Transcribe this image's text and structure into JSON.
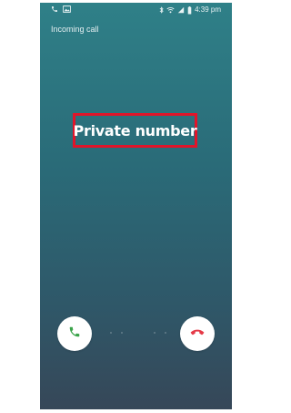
{
  "status_bar": {
    "time": "4:39 pm",
    "left_icons": [
      "phone-icon",
      "image-icon"
    ],
    "right_icons": [
      "bluetooth-icon",
      "wifi-icon",
      "signal-icon",
      "battery-icon"
    ]
  },
  "call": {
    "label": "Incoming call",
    "caller": "Private number"
  },
  "buttons": {
    "answer_icon": "phone-answer-icon",
    "decline_icon": "phone-decline-icon",
    "answer_color": "#3aa34a",
    "decline_color": "#e53947"
  },
  "colors": {
    "highlight_box": "#e0152a"
  }
}
